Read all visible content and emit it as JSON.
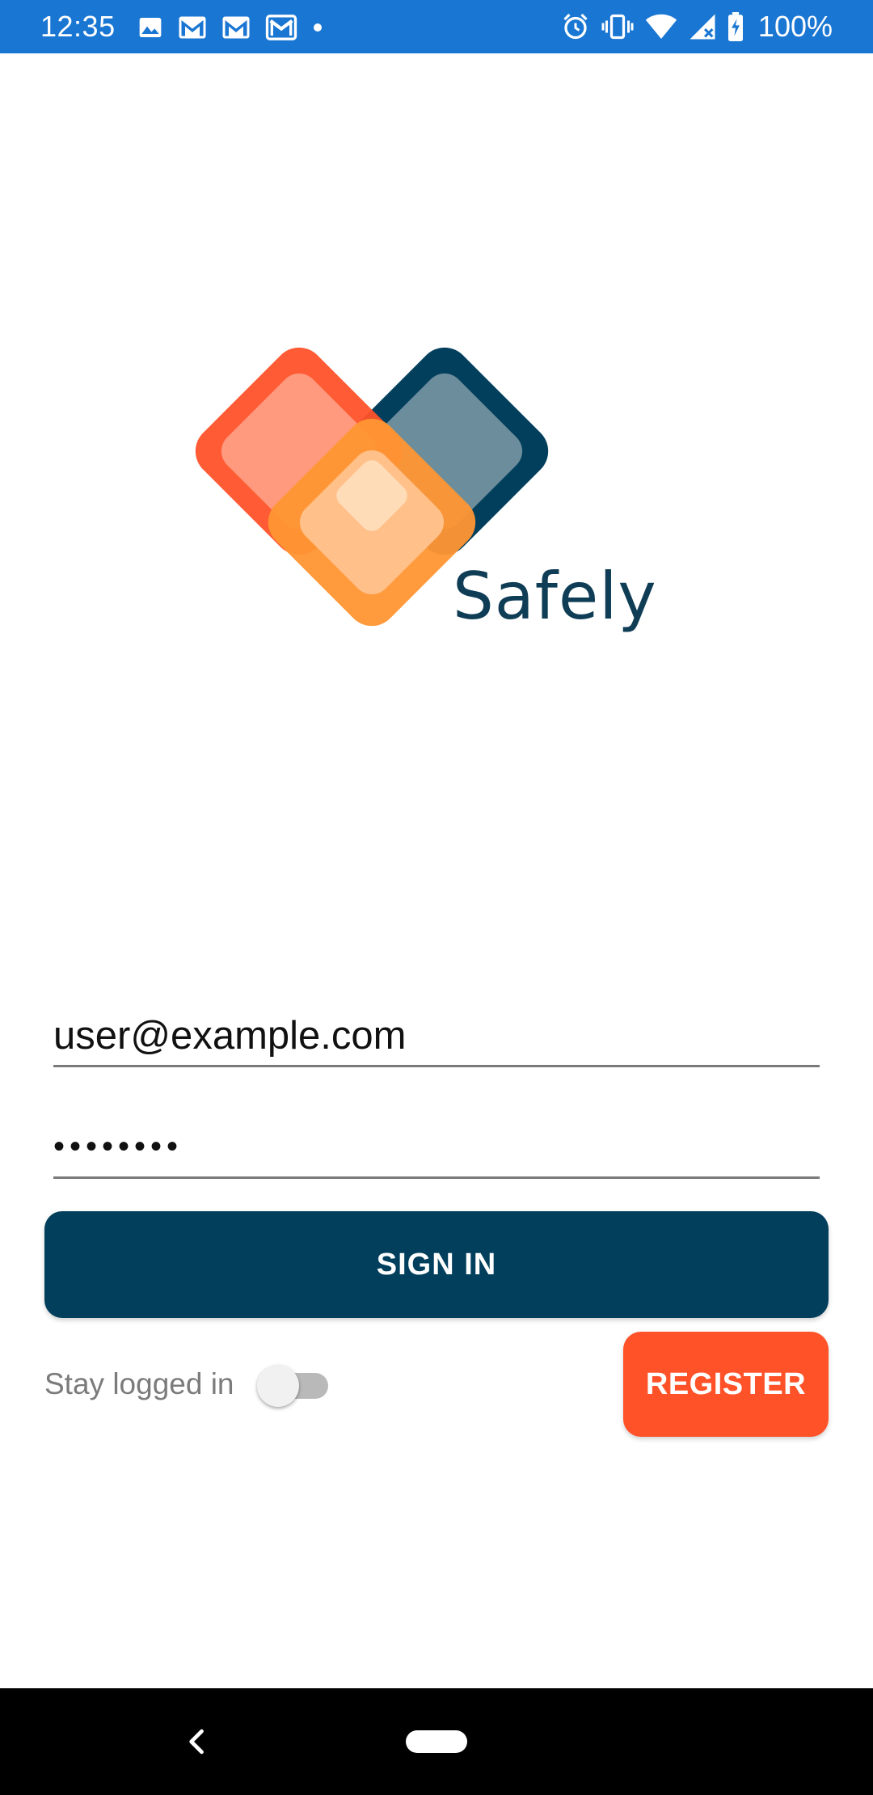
{
  "status_bar": {
    "time": "12:35",
    "battery_percent": "100%",
    "background_color": "#1976d2",
    "left_icons": [
      "image-icon",
      "gmail-icon",
      "gmail-icon",
      "gmail-outline-icon",
      "dot-icon"
    ],
    "right_icons": [
      "alarm-icon",
      "vibrate-icon",
      "wifi-icon",
      "signal-icon",
      "battery-charging-icon"
    ]
  },
  "logo": {
    "wordmark": "Safely",
    "colors": {
      "orange_red": "#ff5229",
      "navy": "#023f5c",
      "orange": "#ff9633"
    }
  },
  "login_form": {
    "email_value": "user@example.com",
    "password_value": "••••••••",
    "sign_in_label": "SIGN IN",
    "stay_logged_in_label": "Stay logged in",
    "stay_logged_in_enabled": false,
    "register_label": "REGISTER",
    "colors": {
      "sign_in": "#023f5c",
      "register": "#ff5229"
    }
  },
  "nav_bar": {
    "icons": [
      "back-icon",
      "home-pill-icon"
    ]
  }
}
